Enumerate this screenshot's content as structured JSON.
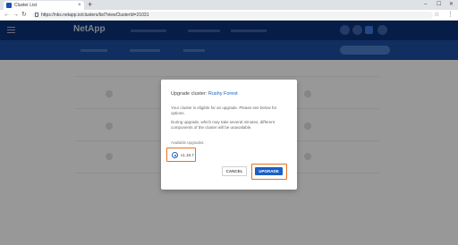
{
  "browser": {
    "tab_title": "Cluster List",
    "tab_close": "×",
    "new_tab": "+",
    "url": "https://nks.netapp.io/clusters/list?viewClusterId=21031",
    "win_min": "–",
    "win_max": "☐",
    "win_close": "✕"
  },
  "icons": {
    "back": "←",
    "forward": "→",
    "reload": "↻",
    "star": "☆",
    "menu": "⋮"
  },
  "app": {
    "logo": "NetApp"
  },
  "modal": {
    "title_prefix": "Upgrade cluster:",
    "cluster_name": "Rushy Forest",
    "eligible_text": "Your cluster is eligible for an upgrade. Please see below for options.",
    "warning_text": "During upgrade, which may take several minutes, different components of the cluster will be unavailable.",
    "available_label": "Available Upgrades:",
    "upgrade_option": "v1.18.7",
    "cancel_label": "CANCEL",
    "upgrade_label": "UPGRADE"
  },
  "colors": {
    "accent": "#1a5fc8",
    "highlight": "#e8721d",
    "header": "#0a2f73"
  }
}
